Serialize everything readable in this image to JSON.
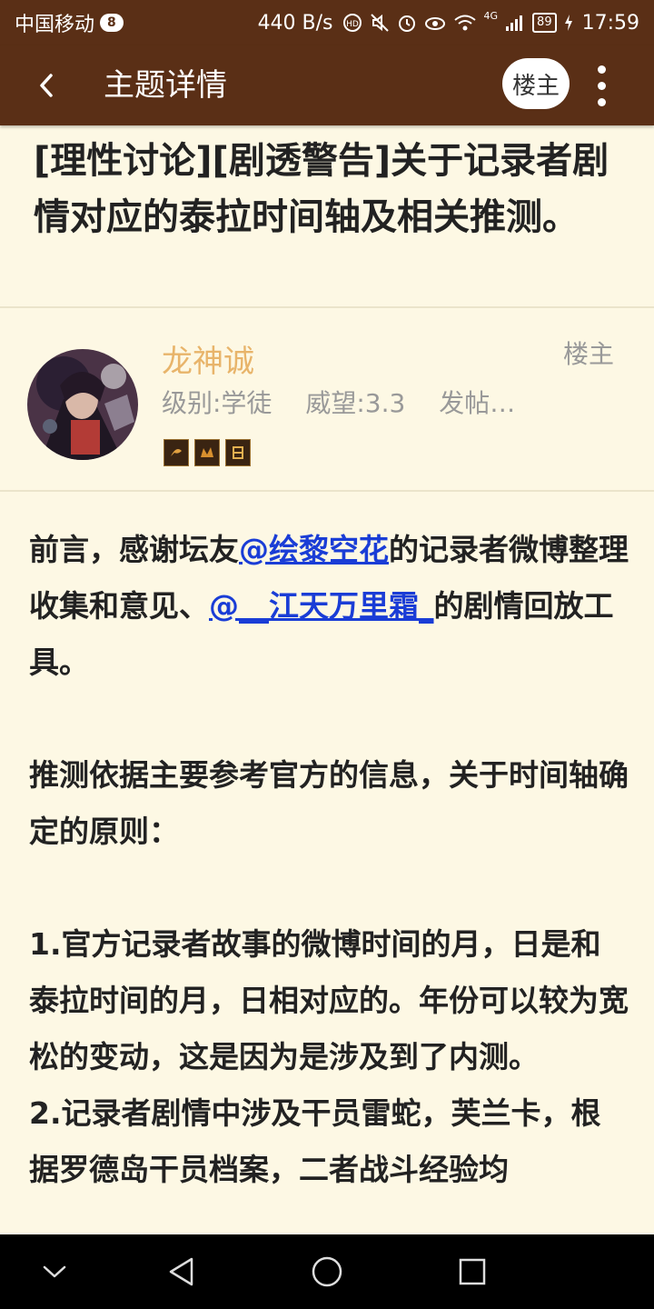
{
  "status_bar": {
    "carrier": "中国移动",
    "sim": "8",
    "speed": "440 B/s",
    "network": "4G",
    "battery": "89",
    "time": "17:59"
  },
  "app_bar": {
    "title": "主题详情",
    "op_button": "楼主"
  },
  "post": {
    "title": "[理性讨论][剧透警告]关于记录者剧情对应的泰拉时间轴及相关推测。"
  },
  "author": {
    "name": "龙神诚",
    "op_label": "楼主",
    "level": "级别:学徒",
    "prestige": "威望:3.3",
    "posts": "发帖…"
  },
  "content": {
    "p1_a": "前言，感谢坛友",
    "mention1": "@绘黎空花",
    "p1_b": "的记录者微博整理收集和意见、",
    "mention2": "@__江天万里霜_",
    "p1_c": "的剧情回放工具。",
    "p2": "推测依据主要参考官方的信息，关于时间轴确定的原则：",
    "p3": "1.官方记录者故事的微博时间的月，日是和泰拉时间的月，日相对应的。年份可以较为宽松的变动，这是因为是涉及到了内测。",
    "p4": "2.记录者剧情中涉及干员雷蛇，芙兰卡，根据罗德岛干员档案，二者战斗经验均"
  },
  "colors": {
    "header_bg": "#5a2f16",
    "page_bg": "#fdf8e4",
    "author_name": "#e8b46a",
    "link": "#1a3dd6"
  },
  "icons": [
    "back-arrow-icon",
    "more-vert-icon",
    "nav-collapse-icon",
    "nav-back-icon",
    "nav-home-icon",
    "nav-recents-icon"
  ]
}
